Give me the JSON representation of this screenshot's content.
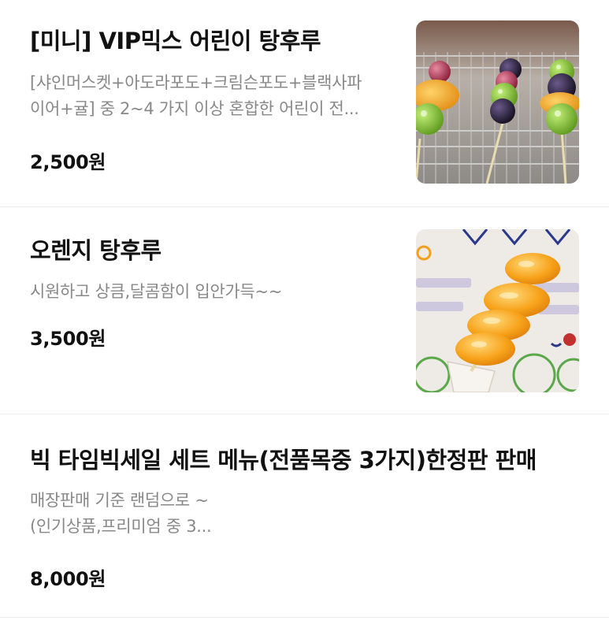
{
  "menu": {
    "items": [
      {
        "title": "[미니] VIP믹스 어린이 탕후루",
        "description_lines": [
          "[샤인머스켓+아도라포도+크림슨포도+블랙사파",
          "이어+귤] 중 2~4 가지 이상 혼합한 어린이 전..."
        ],
        "price": "2,500원",
        "image": "mixed-fruit-tanghulu-skewers-photo"
      },
      {
        "title": "오렌지 탕후루",
        "description_lines": [
          "시원하고 상큼,달콤함이 입안가득~~"
        ],
        "price": "3,500원",
        "image": "orange-tanghulu-skewer-photo"
      },
      {
        "title": "빅 타임빅세일 세트 메뉴(전품목중  3가지)한정판 판매",
        "description_lines": [
          "매장판매 기준 랜덤으로 ~",
          "(인기상품,프리미엄 중 3..."
        ],
        "price": "8,000원"
      }
    ]
  },
  "colors": {
    "title": "#111111",
    "description": "#888888",
    "price": "#111111",
    "divider": "#ececec"
  }
}
